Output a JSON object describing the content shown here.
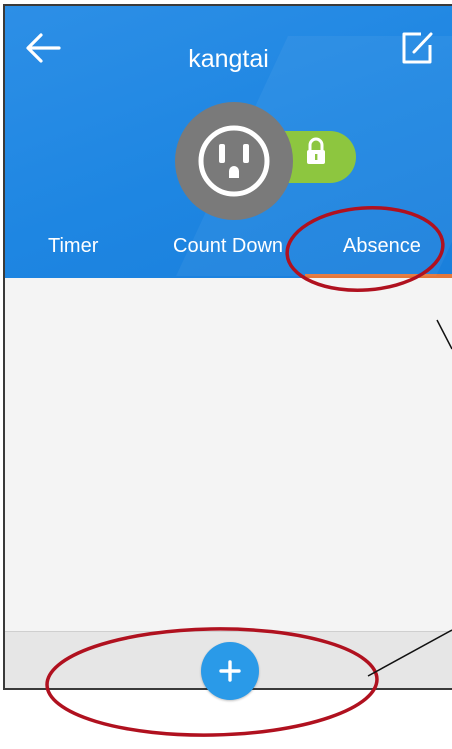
{
  "header": {
    "title": "kangtai",
    "back_icon": "arrow-left-icon",
    "edit_icon": "edit-icon"
  },
  "device": {
    "icon": "power-outlet-icon",
    "lock_icon": "padlock-icon",
    "lock_indicator_color": "#8dc63f"
  },
  "tabs": [
    {
      "label": "Timer",
      "active": false
    },
    {
      "label": "Count Down",
      "active": false
    },
    {
      "label": "Absence",
      "active": true
    }
  ],
  "bottom_bar": {
    "add_icon": "plus-icon"
  },
  "colors": {
    "header_blue": "#1e86e2",
    "tab_underline": "#e4773a",
    "add_button": "#2a9ae8",
    "annotation_red": "#b0111f"
  }
}
